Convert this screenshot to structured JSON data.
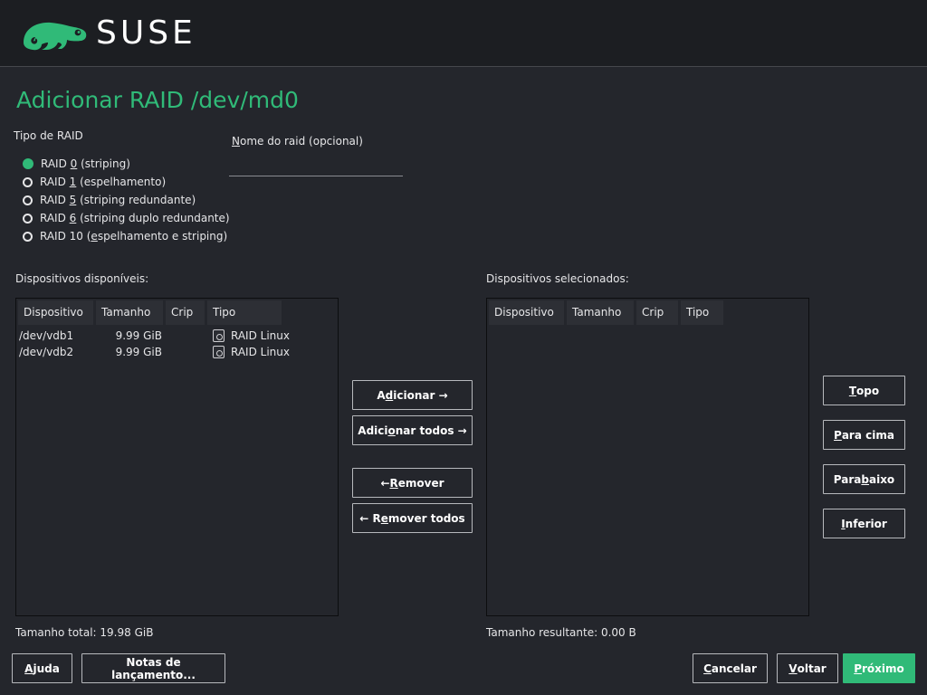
{
  "brand": {
    "name": "SUSE",
    "logo": "chameleon-logo"
  },
  "page": {
    "title": "Adicionar RAID /dev/md0"
  },
  "raid_type": {
    "label": "Tipo de RAID",
    "options": [
      {
        "pre": "RAID ",
        "key": "0",
        "post": " (striping)",
        "checked": true
      },
      {
        "pre": "RAID ",
        "key": "1",
        "post": " (espelhamento)",
        "checked": false
      },
      {
        "pre": "RAID ",
        "key": "5",
        "post": " (striping redundante)",
        "checked": false
      },
      {
        "pre": "RAID ",
        "key": "6",
        "post": " (striping duplo redundante)",
        "checked": false
      },
      {
        "pre": "RAID 10 (",
        "key": "e",
        "post": "spelhamento e striping)",
        "checked": false
      }
    ]
  },
  "raid_name": {
    "label_key": "N",
    "label_rest": "ome do raid (opcional)",
    "value": ""
  },
  "available": {
    "label": "Dispositivos disponíveis:",
    "columns": [
      "Dispositivo",
      "Tamanho",
      "Crip",
      "Tipo"
    ],
    "rows": [
      {
        "device": "/dev/vdb1",
        "size": "9.99 GiB",
        "crypt": "",
        "type": "RAID Linux",
        "icon": "disk-icon"
      },
      {
        "device": "/dev/vdb2",
        "size": "9.99 GiB",
        "crypt": "",
        "type": "RAID Linux",
        "icon": "disk-icon"
      }
    ],
    "total": "Tamanho total: 19.98 GiB"
  },
  "selected": {
    "label": "Dispositivos selecionados:",
    "columns": [
      "Dispositivo",
      "Tamanho",
      "Crip",
      "Tipo"
    ],
    "rows": [],
    "total": "Tamanho resultante: 0.00 B"
  },
  "transfer_buttons": {
    "add": {
      "pre": "A",
      "key": "d",
      "post": "icionar →"
    },
    "add_all": {
      "pre": "Adici",
      "key": "o",
      "post": "nar todos →"
    },
    "remove": {
      "pre": "← ",
      "key": "R",
      "post": "emover"
    },
    "remove_all": {
      "pre": "← R",
      "key": "e",
      "post": "mover todos"
    }
  },
  "order_buttons": {
    "top": {
      "pre": "",
      "key": "T",
      "post": "opo"
    },
    "up": {
      "pre": "",
      "key": "P",
      "post": "ara cima"
    },
    "down": {
      "pre": "Para ",
      "key": "b",
      "post": "aixo"
    },
    "bottom": {
      "pre": "",
      "key": "I",
      "post": "nferior"
    }
  },
  "footer": {
    "help": {
      "pre": "",
      "key": "A",
      "post": "juda"
    },
    "release_notes": "Notas de lançamento...",
    "cancel": {
      "pre": "",
      "key": "C",
      "post": "ancelar"
    },
    "back": {
      "pre": "",
      "key": "V",
      "post": "oltar"
    },
    "next": {
      "pre": "",
      "key": "P",
      "post": "róximo"
    }
  },
  "colors": {
    "accent": "#30ba78",
    "background": "#24262c",
    "header": "#1c1e22"
  }
}
